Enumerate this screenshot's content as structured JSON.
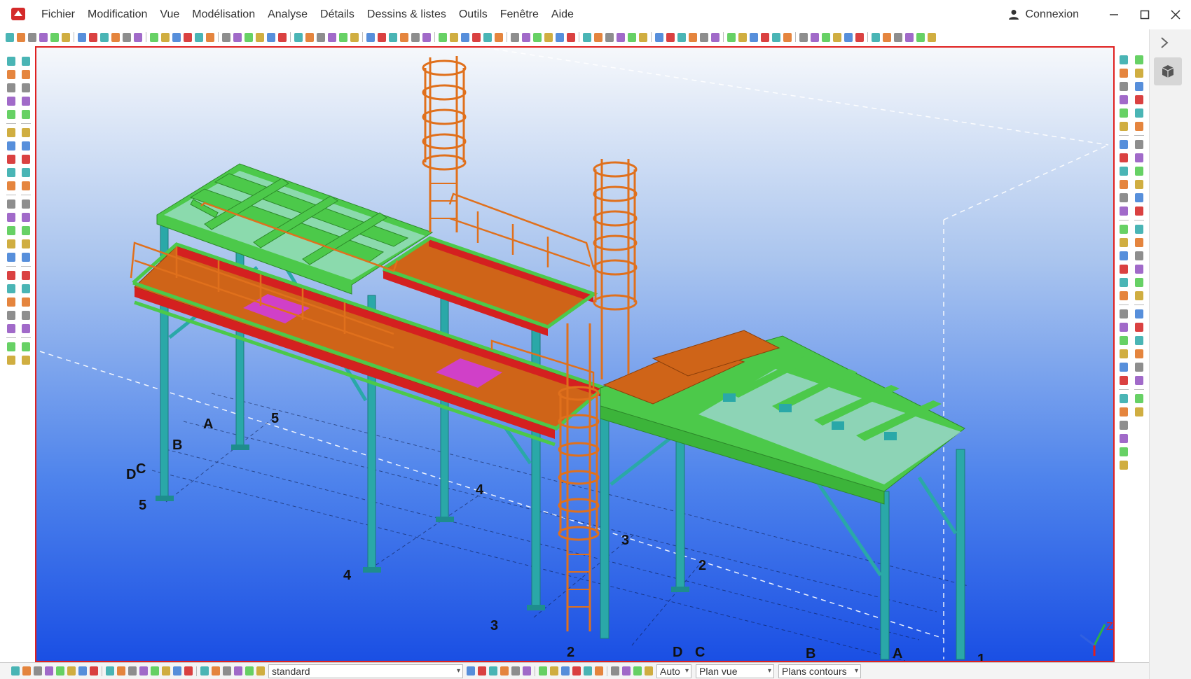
{
  "menubar": {
    "items": [
      "Fichier",
      "Modification",
      "Vue",
      "Modélisation",
      "Analyse",
      "Détails",
      "Dessins & listes",
      "Outils",
      "Fenêtre",
      "Aide"
    ],
    "login_label": "Connexion"
  },
  "statusbar": {
    "selection_filter": "standard",
    "snap_mode": "Auto",
    "view_plane": "Plan vue",
    "contour_plane": "Plans contours"
  },
  "scene": {
    "grid_labels": [
      "A",
      "B",
      "C",
      "D",
      "5",
      "5",
      "4",
      "4",
      "3",
      "3",
      "2",
      "2",
      "D",
      "C",
      "B",
      "A",
      "1"
    ],
    "axis_marker": "Z"
  },
  "colors": {
    "viewport_border": "#e02020",
    "sky_top": "#f4f7fb",
    "sky_bottom": "#1e56e6",
    "beam_green": "#4cc94a",
    "column_teal": "#2aa8a8",
    "ladder_orange": "#e0701c",
    "deck_orange": "#cf6418",
    "beam_red": "#d42020",
    "plate_magenta": "#d040c8"
  },
  "icons": [
    "app-logo-icon",
    "user-icon",
    "minimize-icon",
    "maximize-icon",
    "close-icon",
    "chevron-right-icon",
    "cube-icon"
  ]
}
